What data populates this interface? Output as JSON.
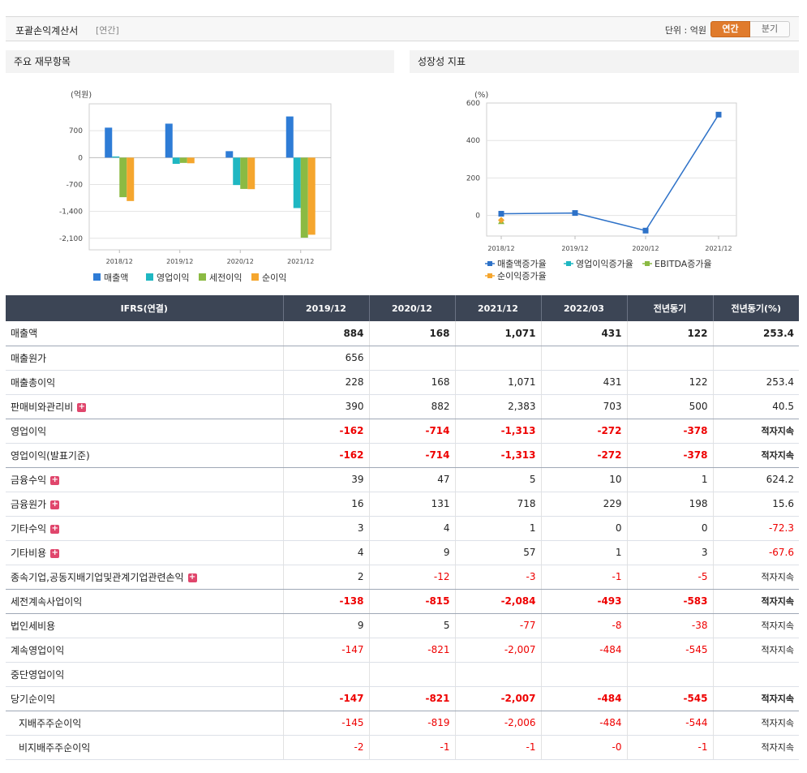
{
  "header": {
    "title": "포괄손익계산서",
    "period": "[연간]",
    "unit_label": "단위 : 억원",
    "btn_annual": "연간",
    "btn_quarter": "분기"
  },
  "panels": {
    "left_title": "주요 재무항목",
    "right_title": "성장성 지표"
  },
  "chart_data": [
    {
      "type": "bar",
      "ylabel": "(억원)",
      "y_ticks": [
        "700",
        "0",
        "-700",
        "-1,400",
        "-2,100"
      ],
      "categories": [
        "2018/12",
        "2019/12",
        "2020/12",
        "2021/12"
      ],
      "ylim": [
        -2100,
        1400
      ],
      "series": [
        {
          "name": "매출액",
          "color": "#2e7cd6",
          "values": [
            780,
            884,
            168,
            1071
          ]
        },
        {
          "name": "영업이익",
          "color": "#1fb7c2",
          "values": [
            30,
            -162,
            -714,
            -1313
          ]
        },
        {
          "name": "세전이익",
          "color": "#8bba43",
          "values": [
            -1030,
            -138,
            -815,
            -2084
          ]
        },
        {
          "name": "순이익",
          "color": "#f5a62e",
          "values": [
            -1130,
            -147,
            -821,
            -2007
          ]
        }
      ],
      "grid": true,
      "legend": "bottom"
    },
    {
      "type": "line",
      "ylabel": "(%)",
      "y_ticks": [
        "600",
        "400",
        "200",
        "0"
      ],
      "categories": [
        "2018/12",
        "2019/12",
        "2020/12",
        "2021/12"
      ],
      "ylim": [
        -100,
        600
      ],
      "series": [
        {
          "name": "매출액증가율",
          "color": "#2e72c8",
          "values": [
            9,
            13,
            -81,
            538
          ]
        },
        {
          "name": "영업이익증가율",
          "color": "#1fb7c2",
          "values": [
            null,
            null,
            null,
            null
          ]
        },
        {
          "name": "EBITDA증가율",
          "color": "#8bba43",
          "values": [
            -33,
            null,
            null,
            null
          ]
        },
        {
          "name": "순이익증가율",
          "color": "#f5a62e",
          "values": [
            -25,
            null,
            null,
            null
          ]
        }
      ],
      "grid": true,
      "legend": "bottom"
    }
  ],
  "table": {
    "head": [
      "IFRS(연결)",
      "2019/12",
      "2020/12",
      "2021/12",
      "2022/03",
      "전년동기",
      "전년동기(%)"
    ],
    "rows": [
      {
        "label": "매출액",
        "bold": true,
        "plus": false,
        "sub": false,
        "vals": [
          "884",
          "168",
          "1,071",
          "431",
          "122",
          "253.4"
        ],
        "neg": [
          false,
          false,
          false,
          false,
          false,
          false
        ]
      },
      {
        "label": "매출원가",
        "bold": false,
        "plus": false,
        "sub": false,
        "vals": [
          "656",
          "",
          "",
          "",
          "",
          ""
        ],
        "neg": [
          false,
          false,
          false,
          false,
          false,
          false
        ]
      },
      {
        "label": "매출총이익",
        "bold": false,
        "plus": false,
        "sub": false,
        "vals": [
          "228",
          "168",
          "1,071",
          "431",
          "122",
          "253.4"
        ],
        "neg": [
          false,
          false,
          false,
          false,
          false,
          false
        ]
      },
      {
        "label": "판매비와관리비",
        "bold": false,
        "plus": true,
        "sub": false,
        "vals": [
          "390",
          "882",
          "2,383",
          "703",
          "500",
          "40.5"
        ],
        "neg": [
          false,
          false,
          false,
          false,
          false,
          false
        ]
      },
      {
        "label": "영업이익",
        "bold": true,
        "plus": false,
        "sub": false,
        "vals": [
          "-162",
          "-714",
          "-1,313",
          "-272",
          "-378",
          "적자지속"
        ],
        "neg": [
          true,
          true,
          true,
          true,
          true,
          false
        ]
      },
      {
        "label": "영업이익(발표기준)",
        "bold": true,
        "plus": false,
        "sub": false,
        "vals": [
          "-162",
          "-714",
          "-1,313",
          "-272",
          "-378",
          "적자지속"
        ],
        "neg": [
          true,
          true,
          true,
          true,
          true,
          false
        ]
      },
      {
        "label": "금융수익",
        "bold": false,
        "plus": true,
        "sub": false,
        "vals": [
          "39",
          "47",
          "5",
          "10",
          "1",
          "624.2"
        ],
        "neg": [
          false,
          false,
          false,
          false,
          false,
          false
        ]
      },
      {
        "label": "금융원가",
        "bold": false,
        "plus": true,
        "sub": false,
        "vals": [
          "16",
          "131",
          "718",
          "229",
          "198",
          "15.6"
        ],
        "neg": [
          false,
          false,
          false,
          false,
          false,
          false
        ]
      },
      {
        "label": "기타수익",
        "bold": false,
        "plus": true,
        "sub": false,
        "vals": [
          "3",
          "4",
          "1",
          "0",
          "0",
          "-72.3"
        ],
        "neg": [
          false,
          false,
          false,
          false,
          false,
          true
        ]
      },
      {
        "label": "기타비용",
        "bold": false,
        "plus": true,
        "sub": false,
        "vals": [
          "4",
          "9",
          "57",
          "1",
          "3",
          "-67.6"
        ],
        "neg": [
          false,
          false,
          false,
          false,
          false,
          true
        ]
      },
      {
        "label": "종속기업,공동지배기업및관계기업관련손익",
        "bold": false,
        "plus": true,
        "sub": false,
        "vals": [
          "2",
          "-12",
          "-3",
          "-1",
          "-5",
          "적자지속"
        ],
        "neg": [
          false,
          true,
          true,
          true,
          true,
          false
        ]
      },
      {
        "label": "세전계속사업이익",
        "bold": true,
        "plus": false,
        "sub": false,
        "vals": [
          "-138",
          "-815",
          "-2,084",
          "-493",
          "-583",
          "적자지속"
        ],
        "neg": [
          true,
          true,
          true,
          true,
          true,
          false
        ]
      },
      {
        "label": "법인세비용",
        "bold": false,
        "plus": false,
        "sub": false,
        "vals": [
          "9",
          "5",
          "-77",
          "-8",
          "-38",
          "적자지속"
        ],
        "neg": [
          false,
          false,
          true,
          true,
          true,
          false
        ]
      },
      {
        "label": "계속영업이익",
        "bold": false,
        "plus": false,
        "sub": false,
        "vals": [
          "-147",
          "-821",
          "-2,007",
          "-484",
          "-545",
          "적자지속"
        ],
        "neg": [
          true,
          true,
          true,
          true,
          true,
          false
        ]
      },
      {
        "label": "중단영업이익",
        "bold": false,
        "plus": false,
        "sub": false,
        "vals": [
          "",
          "",
          "",
          "",
          "",
          ""
        ],
        "neg": [
          false,
          false,
          false,
          false,
          false,
          false
        ]
      },
      {
        "label": "당기순이익",
        "bold": true,
        "plus": false,
        "sub": false,
        "vals": [
          "-147",
          "-821",
          "-2,007",
          "-484",
          "-545",
          "적자지속"
        ],
        "neg": [
          true,
          true,
          true,
          true,
          true,
          false
        ]
      },
      {
        "label": "지배주주순이익",
        "bold": false,
        "plus": false,
        "sub": true,
        "vals": [
          "-145",
          "-819",
          "-2,006",
          "-484",
          "-544",
          "적자지속"
        ],
        "neg": [
          true,
          true,
          true,
          true,
          true,
          false
        ]
      },
      {
        "label": "비지배주주순이익",
        "bold": false,
        "plus": false,
        "sub": true,
        "vals": [
          "-2",
          "-1",
          "-1",
          "-0",
          "-1",
          "적자지속"
        ],
        "neg": [
          true,
          true,
          true,
          true,
          true,
          false
        ]
      }
    ]
  }
}
